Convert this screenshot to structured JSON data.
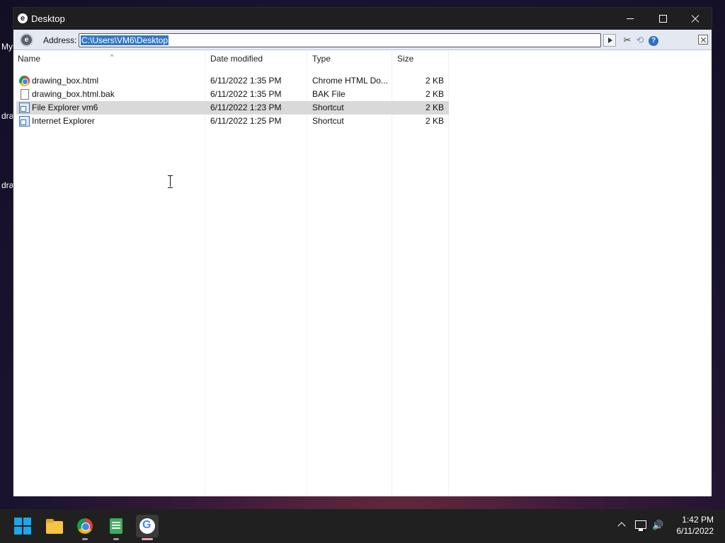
{
  "desktop": {
    "labels": [
      "My",
      "dra",
      "dra"
    ]
  },
  "window": {
    "title": "Desktop",
    "app_icon": "e"
  },
  "addressbar": {
    "label": "Address:",
    "value": "C:\\Users\\VM6\\Desktop",
    "icons": [
      "ie-logo-icon",
      "go-arrow-icon",
      "tools-icon",
      "refresh-icon",
      "help-icon",
      "close-icon"
    ],
    "help_glyph": "?"
  },
  "columns": {
    "name": "Name",
    "date": "Date modified",
    "type": "Type",
    "size": "Size"
  },
  "files": [
    {
      "name": "drawing_box.html",
      "date": "6/11/2022 1:35 PM",
      "type": "Chrome HTML Do...",
      "size": "2 KB",
      "icon": "chrome-icon",
      "selected": false
    },
    {
      "name": "drawing_box.html.bak",
      "date": "6/11/2022 1:35 PM",
      "type": "BAK File",
      "size": "2 KB",
      "icon": "file-icon",
      "selected": false
    },
    {
      "name": "File Explorer vm6",
      "date": "6/11/2022 1:23 PM",
      "type": "Shortcut",
      "size": "2 KB",
      "icon": "shortcut-icon",
      "selected": true
    },
    {
      "name": "Internet Explorer",
      "date": "6/11/2022 1:25 PM",
      "type": "Shortcut",
      "size": "2 KB",
      "icon": "shortcut-icon",
      "selected": false
    }
  ],
  "taskbar": {
    "apps": [
      "start-icon",
      "file-explorer-icon",
      "chrome-icon",
      "notepad-icon",
      "google-icon"
    ],
    "g_glyph": "G",
    "time": "1:42 PM",
    "date": "6/11/2022"
  },
  "colors": {
    "accent": "#1aa7ec",
    "selection": "#3478c6",
    "titlebar": "#1f1f1f",
    "taskbar": "#202020"
  }
}
